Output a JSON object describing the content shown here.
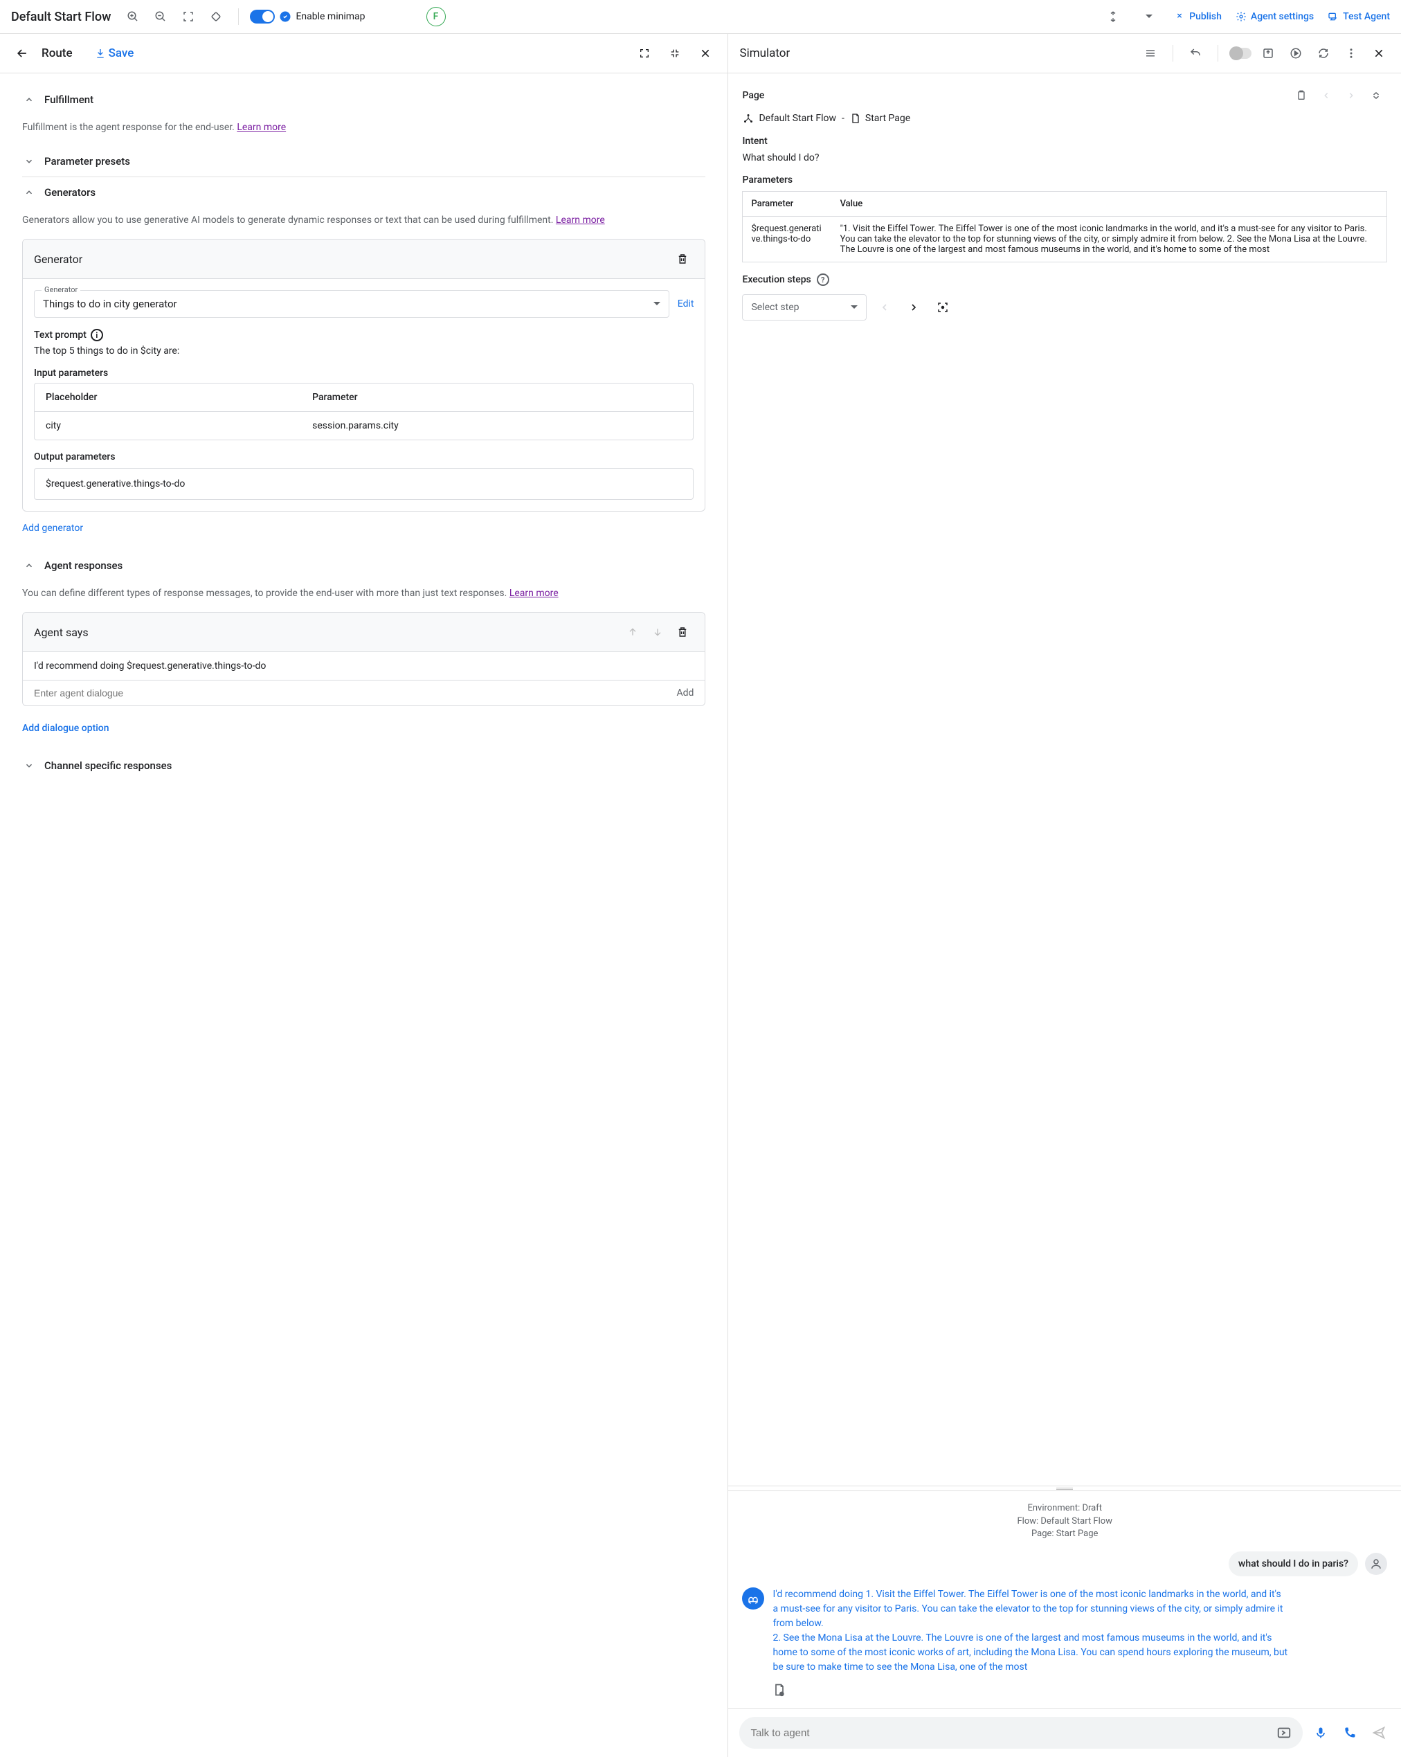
{
  "topbar": {
    "flow_title": "Default Start Flow",
    "minimap_label": "Enable minimap",
    "avatar_letter": "F",
    "publish": "Publish",
    "agent_settings": "Agent settings",
    "test_agent": "Test Agent"
  },
  "left": {
    "title": "Route",
    "save": "Save",
    "fulfillment": {
      "title": "Fulfillment",
      "desc": "Fulfillment is the agent response for the end-user. ",
      "learn_more": "Learn more"
    },
    "param_presets": {
      "title": "Parameter presets"
    },
    "generators": {
      "title": "Generators",
      "desc": "Generators allow you to use generative AI models to generate dynamic responses or text that can be used during fulfillment. ",
      "learn_more": "Learn more",
      "card_title": "Generator",
      "select_label": "Generator",
      "select_value": "Things to do in city generator",
      "edit": "Edit",
      "text_prompt_label": "Text prompt",
      "text_prompt_value": "The top 5 things to do in $city are:",
      "input_params_label": "Input parameters",
      "placeholder_header": "Placeholder",
      "parameter_header": "Parameter",
      "placeholder_value": "city",
      "parameter_value": "session.params.city",
      "output_params_label": "Output parameters",
      "output_value": "$request.generative.things-to-do",
      "add_generator": "Add generator"
    },
    "agent_responses": {
      "title": "Agent responses",
      "desc": "You can define different types of response messages, to provide the end-user with more than just text responses. ",
      "learn_more": "Learn more",
      "card_title": "Agent says",
      "response_text": "I'd recommend doing $request.generative.things-to-do",
      "placeholder": "Enter agent dialogue",
      "add_text": "Add",
      "add_dialogue": "Add dialogue option"
    },
    "channel": {
      "title": "Channel specific responses"
    }
  },
  "right": {
    "title": "Simulator",
    "page_label": "Page",
    "breadcrumb1": "Default Start Flow",
    "breadcrumb2": "Start Page",
    "intent_label": "Intent",
    "intent_value": "What should I do?",
    "params_label": "Parameters",
    "param_header": "Parameter",
    "value_header": "Value",
    "param_name": "$request.generative.things-to-do",
    "param_value": "\"1. Visit the Eiffel Tower. The Eiffel Tower is one of the most iconic landmarks in the world, and it's a must-see for any visitor to Paris. You can take the elevator to the top for stunning views of the city, or simply admire it from below. 2. See the Mona Lisa at the Louvre. The Louvre is one of the largest and most famous museums in the world, and it's home to some of the most",
    "exec_label": "Execution steps",
    "select_step": "Select step",
    "env": "Environment: Draft",
    "flow": "Flow: Default Start Flow",
    "page": "Page: Start Page",
    "user_msg": "what should I do in paris?",
    "agent_msg": "I'd recommend doing 1. Visit the Eiffel Tower. The Eiffel Tower is one of the most iconic landmarks in the world, and it's a must-see for any visitor to Paris. You can take the elevator to the top for stunning views of the city, or simply admire it from below.\n2. See the Mona Lisa at the Louvre. The Louvre is one of the largest and most famous museums in the world, and it's home to some of the most iconic works of art, including the Mona Lisa. You can spend hours exploring the museum, but be sure to make time to see the Mona Lisa, one of the most",
    "chat_placeholder": "Talk to agent"
  }
}
